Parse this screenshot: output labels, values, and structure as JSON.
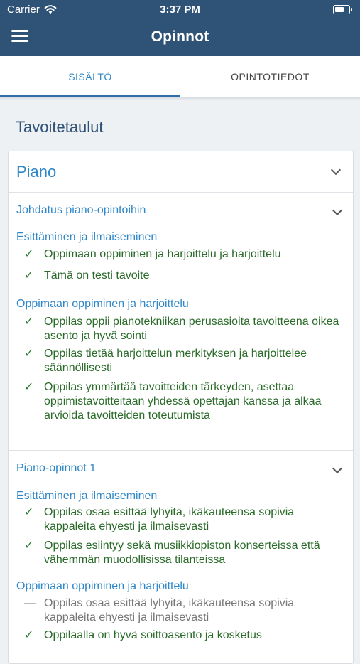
{
  "status": {
    "carrier": "Carrier",
    "time": "3:37 PM"
  },
  "nav": {
    "title": "Opinnot"
  },
  "tabs": [
    {
      "label": "SISÄLTÖ"
    },
    {
      "label": "OPINTOTIEDOT"
    }
  ],
  "page": {
    "section_title": "Tavoitetaulut"
  },
  "card": {
    "title": "Piano",
    "groups": [
      {
        "title": "Johdatus piano-opintoihin",
        "categories": [
          {
            "title": "Esittäminen ja ilmaiseminen",
            "items": [
              {
                "status": "done",
                "text": "Oppimaan oppiminen ja harjoittelu ja harjoittelu"
              },
              {
                "status": "done",
                "text": "Tämä on testi tavoite"
              }
            ]
          },
          {
            "title": "Oppimaan oppiminen ja harjoittelu",
            "items": [
              {
                "status": "done",
                "text": "Oppilas oppii pianotekniikan perusasioita tavoitteena oikea asento ja hyvä sointi"
              },
              {
                "status": "done",
                "text": "Oppilas tietää harjoittelun merkityksen ja harjoittelee säännöllisesti"
              },
              {
                "status": "done",
                "text": "Oppilas ymmärtää tavoitteiden tärkeyden, asettaa oppimistavoitteitaan yhdessä opettajan kanssa ja alkaa arvioida tavoitteiden toteutumista"
              }
            ]
          }
        ]
      },
      {
        "title": "Piano-opinnot 1",
        "categories": [
          {
            "title": "Esittäminen ja ilmaiseminen",
            "items": [
              {
                "status": "done",
                "text": "Oppilas osaa esittää lyhyitä, ikäkauteensa sopivia kappaleita ehyesti ja ilmaisevasti"
              },
              {
                "status": "done",
                "text": "Oppilas esiintyy sekä musiikkiopiston konserteissa että vähemmän muodollisissa tilanteissa"
              }
            ]
          },
          {
            "title": "Oppimaan oppiminen ja harjoittelu",
            "items": [
              {
                "status": "pending",
                "text": "Oppilas osaa esittää lyhyitä, ikäkauteensa sopivia kappaleita ehyesti ja ilmaisevasti"
              },
              {
                "status": "done",
                "text": "Oppilaalla on hyvä soittoasento ja kosketus"
              }
            ]
          }
        ]
      }
    ]
  },
  "colors": {
    "header": "#2f5277",
    "accent": "#2f87c8",
    "done": "#2e7d32",
    "pending": "#888888"
  },
  "icons": {
    "menu": "hamburger-icon",
    "wifi": "wifi-icon",
    "battery": "battery-icon",
    "check": "check-icon",
    "dash": "dash-icon",
    "expand": "chevron-down-icon"
  }
}
